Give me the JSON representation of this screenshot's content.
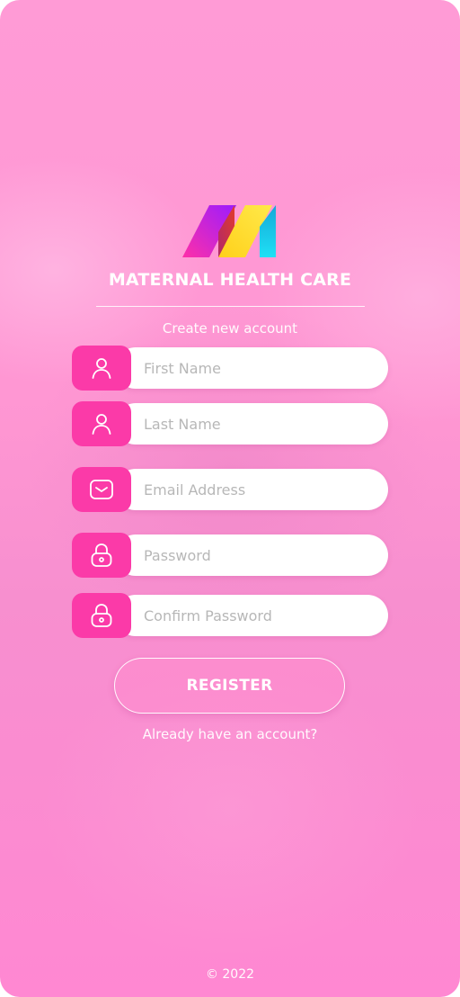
{
  "app": {
    "title": "MATERNAL HEALTH CARE",
    "subtitle": "Create new account"
  },
  "form": {
    "fields": [
      {
        "icon": "user-icon",
        "placeholder": "First Name",
        "value": ""
      },
      {
        "icon": "user-icon",
        "placeholder": "Last Name",
        "value": ""
      },
      {
        "icon": "mail-icon",
        "placeholder": "Email Address",
        "value": ""
      },
      {
        "icon": "lock-icon",
        "placeholder": "Password",
        "value": ""
      },
      {
        "icon": "lock-icon",
        "placeholder": "Confirm Password",
        "value": ""
      }
    ],
    "submit_label": "REGISTER",
    "login_link": "Already have an account?"
  },
  "footer": {
    "copyright": "© 2022"
  },
  "colors": {
    "background": "#ff97d3",
    "accent": "#fb3aa8",
    "field_background": "#ffffff",
    "placeholder": "#b7b7b7"
  }
}
